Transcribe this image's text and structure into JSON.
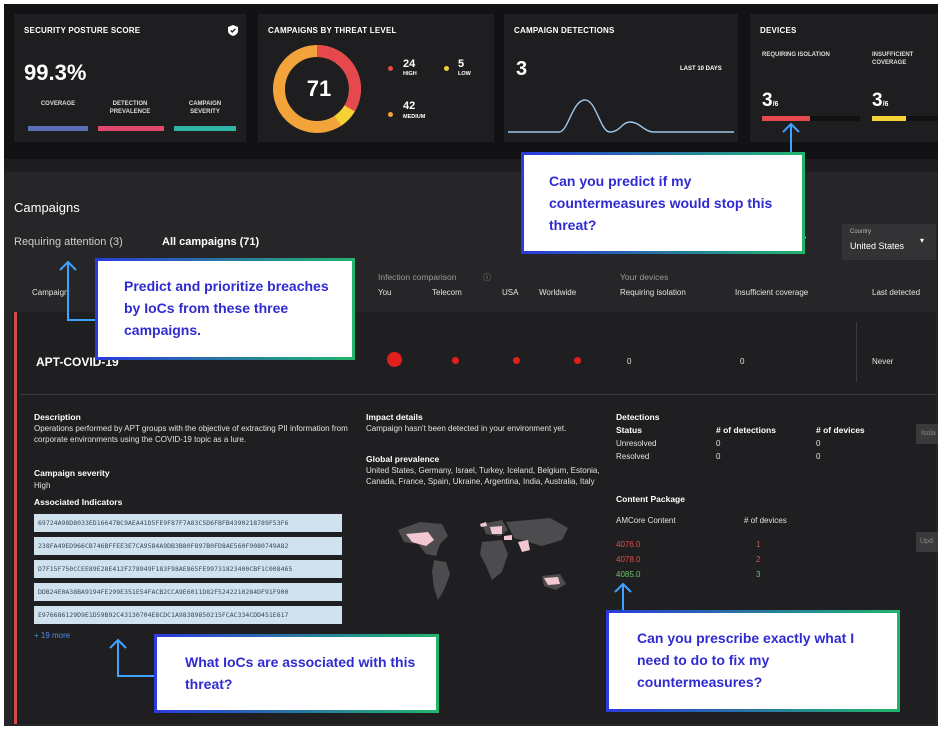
{
  "cards": {
    "posture": {
      "title": "SECURITY POSTURE SCORE",
      "score": "99.3%",
      "metrics": [
        "COVERAGE",
        "DETECTION PREVALENCE",
        "CAMPAIGN SEVERITY"
      ]
    },
    "threat": {
      "title": "CAMPAIGNS BY THREAT LEVEL",
      "total": "71",
      "high_count": "24",
      "high_label": "HIGH",
      "low_count": "5",
      "low_label": "LOW",
      "medium_count": "42",
      "medium_label": "MEDIUM"
    },
    "detections": {
      "title": "CAMPAIGN DETECTIONS",
      "count": "3",
      "period": "LAST 10 DAYS"
    },
    "devices": {
      "title": "DEVICES",
      "isolation_label": "REQUIRING ISOLATION",
      "coverage_label": "INSUFFICIENT COVERAGE",
      "isolation_value": "3",
      "isolation_total": "/6",
      "coverage_value": "3",
      "coverage_total": "/6",
      "isolation_fraction": 0.5,
      "coverage_fraction": 0.5
    }
  },
  "campaigns": {
    "heading": "Campaigns",
    "tabs": [
      "Requiring attention (3)",
      "All campaigns (71)"
    ]
  },
  "filters": {
    "country_label": "Country",
    "country_value": "United States"
  },
  "table": {
    "infection_heading": "Infection comparison",
    "devices_heading": "Your devices",
    "columns": [
      "Campaign",
      "You",
      "Telecom",
      "USA",
      "Worldwide",
      "Requiring isolation",
      "Insufficient coverage",
      "Last detected"
    ]
  },
  "campaign": {
    "name": "APT-COVID-19",
    "requiring_isolation": "0",
    "insufficient_coverage": "0",
    "last_detected": "Never"
  },
  "detail": {
    "description_heading": "Description",
    "description": "Operations performed by APT groups with the objective of extracting PII information from corporate environments using the COVID-19 topic as a lure.",
    "severity_heading": "Campaign severity",
    "severity": "High",
    "indicators_heading": "Associated Indicators",
    "iocs": [
      "69724A98D8033ED16647BC9AEA41D5FE9F87F7A83C5D6FBFB4390218789F53F6",
      "238FA49ED966CB746BFFEE3E7CA9584A9DB3B80F897B0FD8AE560F9080749A82",
      "D7F15F750CCEE89E28E412F278949F183F98AE865FE99731823400CBF1C008465",
      "DDB24E0A38BA9194FE299E351E54FACB2CCA9E6011D82F5242210284DF91F900",
      "E976686129D9E1D59B92C43130704E8CDC1A98389850215FCAC334CDD451E617"
    ],
    "more_link": "+ 19 more",
    "impact_heading": "Impact details",
    "impact": "Campaign hasn't been detected in your environment yet.",
    "prevalence_heading": "Global prevalence",
    "prevalence": "United States, Germany, Israel, Turkey, Iceland, Belgium, Estonia, Canada, France, Spain, Ukraine, Argentina, India, Australia, Italy",
    "detections": {
      "heading": "Detections",
      "columns": [
        "Status",
        "# of detections",
        "# of devices"
      ],
      "rows": [
        {
          "status": "Unresolved",
          "detections": "0",
          "devices": "0"
        },
        {
          "status": "Resolved",
          "detections": "0",
          "devices": "0"
        }
      ]
    },
    "isolate_button": "Isola",
    "content_package": {
      "heading": "Content Package",
      "columns": [
        "AMCore Content",
        "# of devices"
      ],
      "rows": [
        {
          "version": "4076.0",
          "devices": "1"
        },
        {
          "version": "4078.0",
          "devices": "2"
        },
        {
          "version": "4085.0",
          "devices": "3"
        }
      ]
    },
    "update_button": "Upd"
  },
  "callouts": [
    "Can you predict if my countermeasures would stop this threat?",
    "Predict and prioritize breaches by IoCs from these three campaigns.",
    "What IoCs are associated with this threat?",
    "Can you prescribe exactly what I need to do to fix my countermeasures?"
  ],
  "colors": {
    "high": "#e5484d",
    "medium": "#f2a33a",
    "low": "#f4d233",
    "callout_text": "#2f2bd0",
    "callout_border_start": "#2b3bdc",
    "callout_border_end": "#23b46c",
    "resolved_green": "#6bc26e"
  }
}
